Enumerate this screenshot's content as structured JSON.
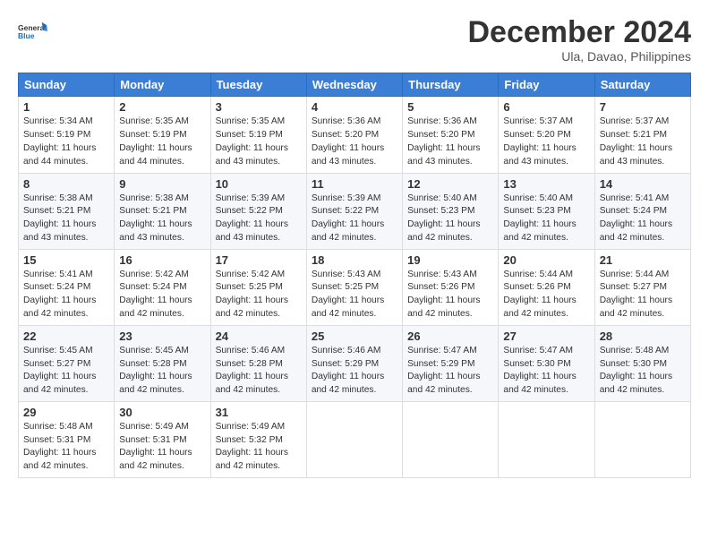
{
  "logo": {
    "line1": "General",
    "line2": "Blue"
  },
  "title": "December 2024",
  "location": "Ula, Davao, Philippines",
  "headers": [
    "Sunday",
    "Monday",
    "Tuesday",
    "Wednesday",
    "Thursday",
    "Friday",
    "Saturday"
  ],
  "weeks": [
    [
      {
        "day": "1",
        "sunrise": "5:34 AM",
        "sunset": "5:19 PM",
        "daylight": "11 hours and 44 minutes."
      },
      {
        "day": "2",
        "sunrise": "5:35 AM",
        "sunset": "5:19 PM",
        "daylight": "11 hours and 44 minutes."
      },
      {
        "day": "3",
        "sunrise": "5:35 AM",
        "sunset": "5:19 PM",
        "daylight": "11 hours and 43 minutes."
      },
      {
        "day": "4",
        "sunrise": "5:36 AM",
        "sunset": "5:20 PM",
        "daylight": "11 hours and 43 minutes."
      },
      {
        "day": "5",
        "sunrise": "5:36 AM",
        "sunset": "5:20 PM",
        "daylight": "11 hours and 43 minutes."
      },
      {
        "day": "6",
        "sunrise": "5:37 AM",
        "sunset": "5:20 PM",
        "daylight": "11 hours and 43 minutes."
      },
      {
        "day": "7",
        "sunrise": "5:37 AM",
        "sunset": "5:21 PM",
        "daylight": "11 hours and 43 minutes."
      }
    ],
    [
      {
        "day": "8",
        "sunrise": "5:38 AM",
        "sunset": "5:21 PM",
        "daylight": "11 hours and 43 minutes."
      },
      {
        "day": "9",
        "sunrise": "5:38 AM",
        "sunset": "5:21 PM",
        "daylight": "11 hours and 43 minutes."
      },
      {
        "day": "10",
        "sunrise": "5:39 AM",
        "sunset": "5:22 PM",
        "daylight": "11 hours and 43 minutes."
      },
      {
        "day": "11",
        "sunrise": "5:39 AM",
        "sunset": "5:22 PM",
        "daylight": "11 hours and 42 minutes."
      },
      {
        "day": "12",
        "sunrise": "5:40 AM",
        "sunset": "5:23 PM",
        "daylight": "11 hours and 42 minutes."
      },
      {
        "day": "13",
        "sunrise": "5:40 AM",
        "sunset": "5:23 PM",
        "daylight": "11 hours and 42 minutes."
      },
      {
        "day": "14",
        "sunrise": "5:41 AM",
        "sunset": "5:24 PM",
        "daylight": "11 hours and 42 minutes."
      }
    ],
    [
      {
        "day": "15",
        "sunrise": "5:41 AM",
        "sunset": "5:24 PM",
        "daylight": "11 hours and 42 minutes."
      },
      {
        "day": "16",
        "sunrise": "5:42 AM",
        "sunset": "5:24 PM",
        "daylight": "11 hours and 42 minutes."
      },
      {
        "day": "17",
        "sunrise": "5:42 AM",
        "sunset": "5:25 PM",
        "daylight": "11 hours and 42 minutes."
      },
      {
        "day": "18",
        "sunrise": "5:43 AM",
        "sunset": "5:25 PM",
        "daylight": "11 hours and 42 minutes."
      },
      {
        "day": "19",
        "sunrise": "5:43 AM",
        "sunset": "5:26 PM",
        "daylight": "11 hours and 42 minutes."
      },
      {
        "day": "20",
        "sunrise": "5:44 AM",
        "sunset": "5:26 PM",
        "daylight": "11 hours and 42 minutes."
      },
      {
        "day": "21",
        "sunrise": "5:44 AM",
        "sunset": "5:27 PM",
        "daylight": "11 hours and 42 minutes."
      }
    ],
    [
      {
        "day": "22",
        "sunrise": "5:45 AM",
        "sunset": "5:27 PM",
        "daylight": "11 hours and 42 minutes."
      },
      {
        "day": "23",
        "sunrise": "5:45 AM",
        "sunset": "5:28 PM",
        "daylight": "11 hours and 42 minutes."
      },
      {
        "day": "24",
        "sunrise": "5:46 AM",
        "sunset": "5:28 PM",
        "daylight": "11 hours and 42 minutes."
      },
      {
        "day": "25",
        "sunrise": "5:46 AM",
        "sunset": "5:29 PM",
        "daylight": "11 hours and 42 minutes."
      },
      {
        "day": "26",
        "sunrise": "5:47 AM",
        "sunset": "5:29 PM",
        "daylight": "11 hours and 42 minutes."
      },
      {
        "day": "27",
        "sunrise": "5:47 AM",
        "sunset": "5:30 PM",
        "daylight": "11 hours and 42 minutes."
      },
      {
        "day": "28",
        "sunrise": "5:48 AM",
        "sunset": "5:30 PM",
        "daylight": "11 hours and 42 minutes."
      }
    ],
    [
      {
        "day": "29",
        "sunrise": "5:48 AM",
        "sunset": "5:31 PM",
        "daylight": "11 hours and 42 minutes."
      },
      {
        "day": "30",
        "sunrise": "5:49 AM",
        "sunset": "5:31 PM",
        "daylight": "11 hours and 42 minutes."
      },
      {
        "day": "31",
        "sunrise": "5:49 AM",
        "sunset": "5:32 PM",
        "daylight": "11 hours and 42 minutes."
      },
      null,
      null,
      null,
      null
    ]
  ]
}
